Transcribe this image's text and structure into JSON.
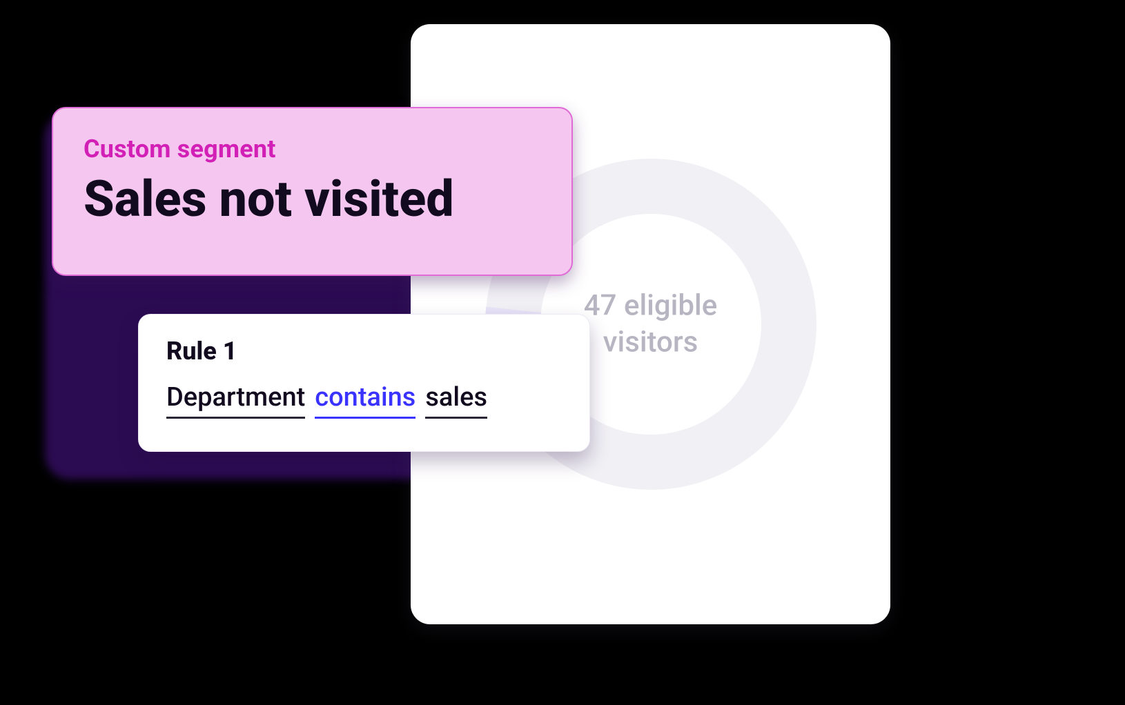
{
  "segment": {
    "eyebrow": "Custom segment",
    "title": "Sales not visited"
  },
  "rule": {
    "title": "Rule 1",
    "field": "Department",
    "operator": "contains",
    "value": "sales"
  },
  "results": {
    "count": 47,
    "label_line1": "47 eligible",
    "label_line2": "visitors",
    "ring_percent": 5
  },
  "colors": {
    "accent_pink": "#d21fb6",
    "card_pink_bg": "#f5c6ef",
    "card_pink_border": "#e06ad6",
    "operator_blue": "#3a32ff",
    "text_dark": "#120b1f",
    "ring_track": "#f1f0f5",
    "ring_arc": "#e7e3f8",
    "results_text": "#b8b5c2",
    "purple_shadow": "#2b0b52"
  }
}
